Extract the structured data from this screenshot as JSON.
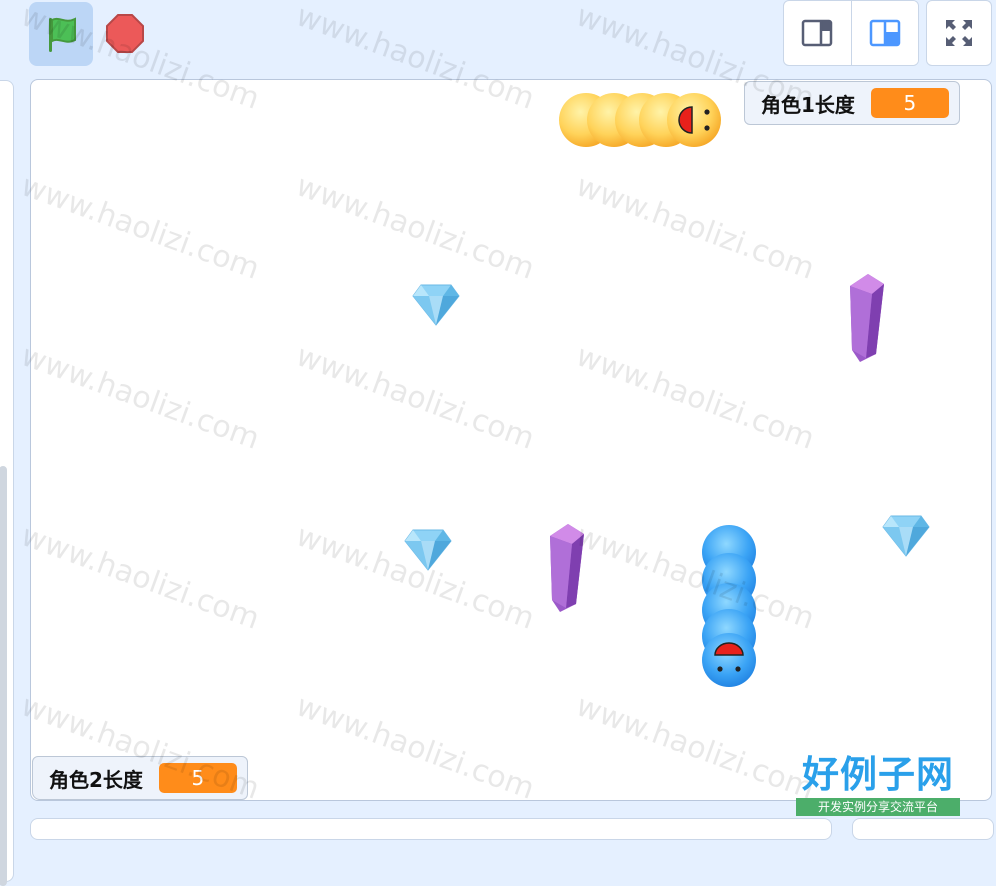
{
  "toolbar": {
    "green_flag_icon": "green-flag-icon",
    "stop_icon": "stop-sign-icon",
    "layout_small_icon": "small-stage-icon",
    "layout_normal_icon": "normal-stage-icon",
    "fullscreen_icon": "fullscreen-icon"
  },
  "monitors": {
    "snake1": {
      "label": "角色1长度",
      "value": "5"
    },
    "snake2": {
      "label": "角色2长度",
      "value": "5"
    }
  },
  "watermark": {
    "text": "www.haolizi.com",
    "logo_title": "好例子网",
    "logo_subtitle": "开发实例分享交流平台"
  },
  "colors": {
    "accent": "#ff8c1a",
    "stage_bg": "#ffffff",
    "page_bg": "#e5f0ff",
    "flag_green": "#4cbf56",
    "stop_red": "#ec5959"
  }
}
